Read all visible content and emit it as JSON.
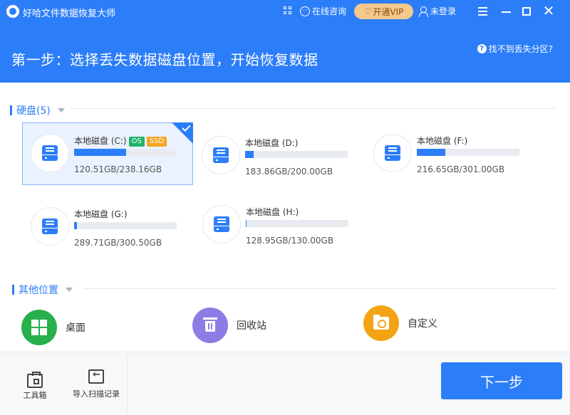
{
  "titlebar": {
    "app_title": "好哈文件数据恢复大师",
    "consult_label": "在线咨询",
    "vip_label": "开通VIP",
    "user_label": "未登录"
  },
  "header": {
    "step_title": "第一步：选择丢失数据磁盘位置，开始恢复数据",
    "help_link": "找不到丢失分区?"
  },
  "disks_section": {
    "title": "硬盘(5)",
    "drives": [
      {
        "name": "本地磁盘 (C:)",
        "tags": [
          "OS",
          "SSD"
        ],
        "size": "120.51GB/238.16GB",
        "used_fraction": 0.506,
        "selected": true
      },
      {
        "name": "本地磁盘 (D:)",
        "tags": [],
        "size": "183.86GB/200.00GB",
        "used_fraction": 0.08,
        "selected": false
      },
      {
        "name": "本地磁盘 (F:)",
        "tags": [],
        "size": "216.65GB/301.00GB",
        "used_fraction": 0.28,
        "selected": false
      },
      {
        "name": "本地磁盘 (G:)",
        "tags": [],
        "size": "289.71GB/300.50GB",
        "used_fraction": 0.03,
        "selected": false
      },
      {
        "name": "本地磁盘 (H:)",
        "tags": [],
        "size": "128.95GB/130.00GB",
        "used_fraction": 0.0,
        "selected": false
      }
    ]
  },
  "other_section": {
    "title": "其他位置",
    "locations": [
      {
        "label": "桌面",
        "icon": "windows-icon",
        "color": "#27b04b"
      },
      {
        "label": "回收站",
        "icon": "trash-icon",
        "color": "#8e7be6"
      },
      {
        "label": "自定义",
        "icon": "folder-search-icon",
        "color": "#f3a314"
      }
    ]
  },
  "footer": {
    "toolbox_label": "工具箱",
    "import_label": "导入扫描记录",
    "next_label": "下一步"
  },
  "colors": {
    "accent": "#2c7ef8",
    "vip": "#f4c98b"
  }
}
